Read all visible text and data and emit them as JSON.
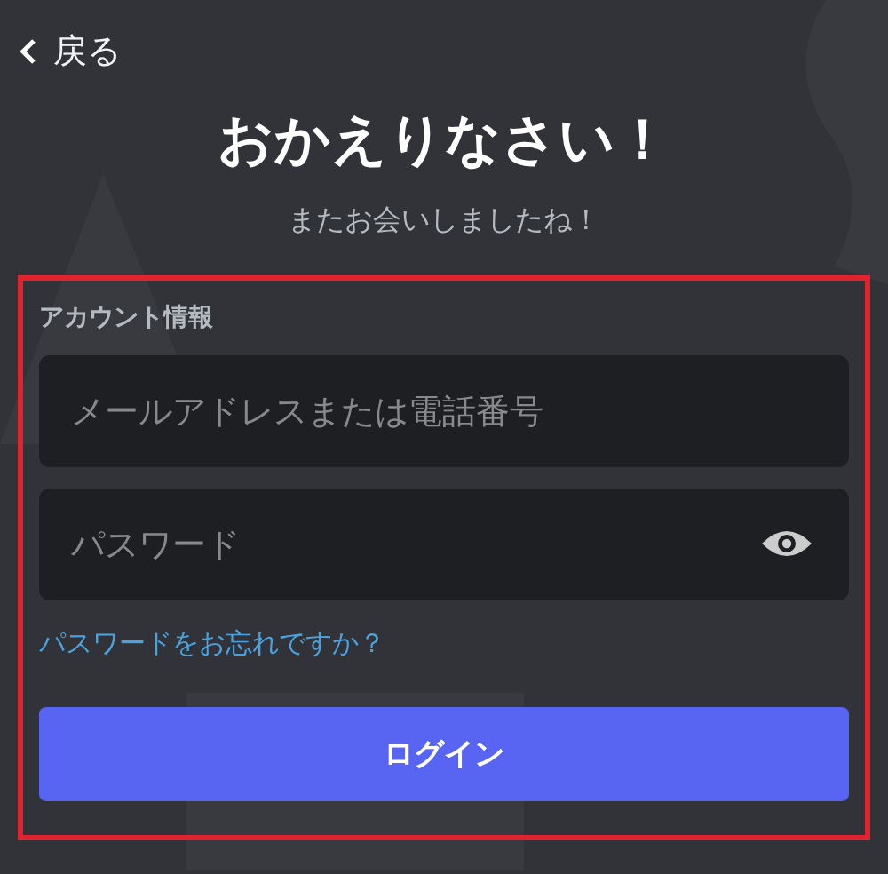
{
  "back": {
    "label": "戻る"
  },
  "title": "おかえりなさい！",
  "subtitle": "またお会いしましたね！",
  "form": {
    "section_label": "アカウント情報",
    "fields": [
      {
        "kind": "text",
        "placeholder": "メールアドレスまたは電話番号"
      },
      {
        "kind": "password",
        "placeholder": "パスワード"
      }
    ],
    "forgot_link": "パスワードをお忘れですか？",
    "submit": "ログイン"
  }
}
